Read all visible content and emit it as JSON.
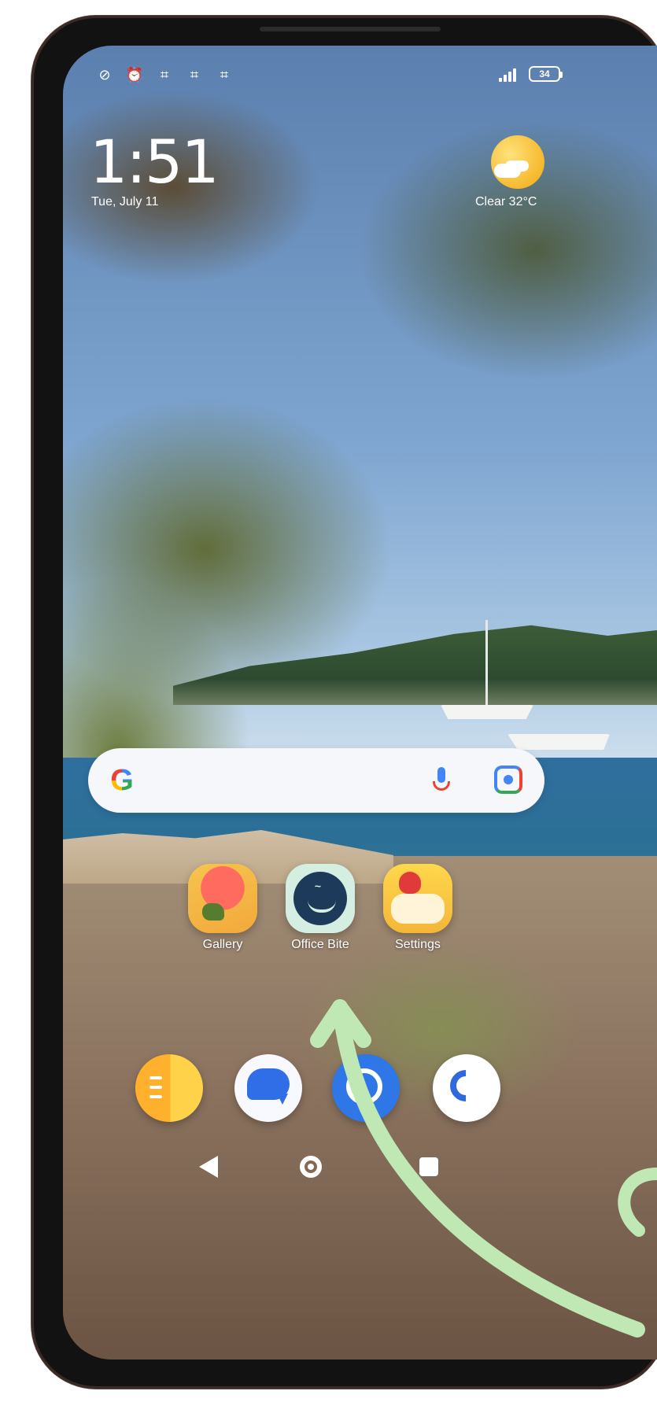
{
  "status_bar": {
    "left_icons": [
      "notification-muted-icon",
      "alarm-icon",
      "signal-status-icon",
      "signal-status-icon",
      "signal-status-icon"
    ],
    "right_icons": [
      "cellular-signal-icon",
      "battery-icon"
    ],
    "battery_level": "34"
  },
  "clock": {
    "time": "1:51",
    "date": "Tue, July 11"
  },
  "weather": {
    "label": "Clear 32°C"
  },
  "search": {
    "logo": "G"
  },
  "apps": [
    {
      "label": "Gallery",
      "icon": "gallery-icon"
    },
    {
      "label": "Office Bite",
      "icon": "office-bite-icon"
    },
    {
      "label": "Settings",
      "icon": "settings-icon"
    }
  ],
  "dock": [
    {
      "icon": "notes-icon"
    },
    {
      "icon": "messages-icon"
    },
    {
      "icon": "browser-icon"
    },
    {
      "icon": "phone-icon"
    }
  ],
  "overlay": {
    "annotation_color": "#bfe8b4"
  },
  "navigation": {
    "back": "back-icon",
    "home": "home-icon",
    "recent": "recent-apps-icon"
  }
}
